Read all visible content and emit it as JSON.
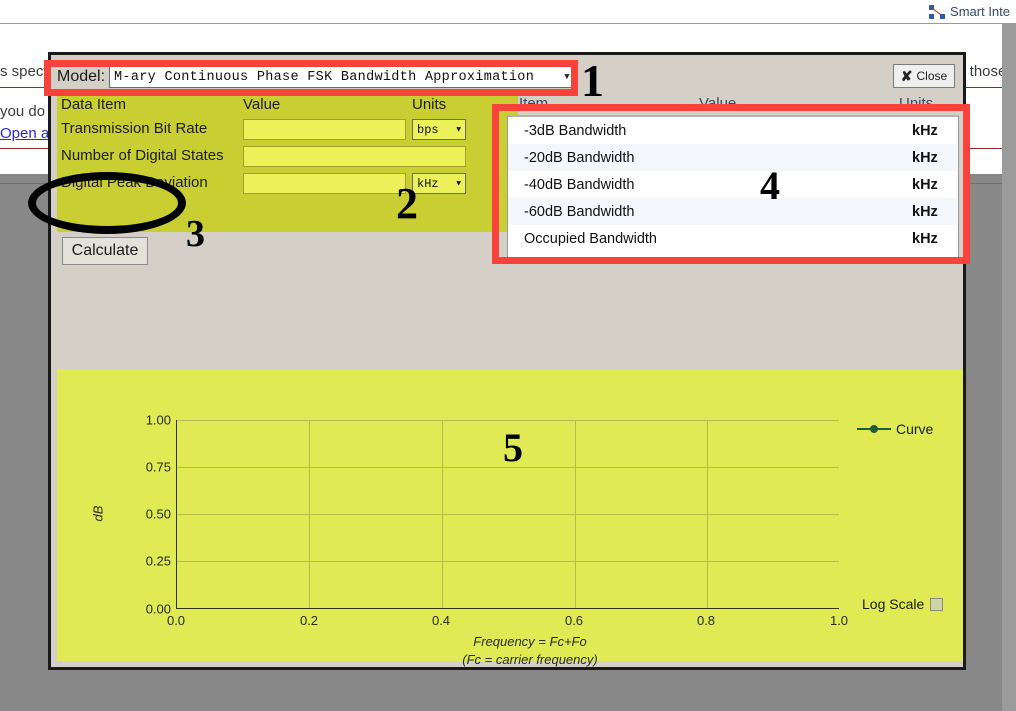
{
  "background": {
    "brand": "Smart Inte",
    "brand_icon": "network-icon",
    "text_left_1": "s spect",
    "text_left_2": "you do",
    "link_left": "Open a",
    "text_right": "s those b"
  },
  "dialog": {
    "model_label": "Model:",
    "model_value": "M-ary Continuous Phase FSK Bandwidth Approximation",
    "close_label": "Close",
    "close_icon": "close-x-icon",
    "form": {
      "headers": {
        "data_item": "Data Item",
        "value": "Value",
        "units": "Units"
      },
      "rows": [
        {
          "label": "Transmission Bit Rate",
          "value": "",
          "unit": "bps",
          "has_unit": true
        },
        {
          "label": "Number of Digital States",
          "value": "",
          "unit": "",
          "has_unit": false
        },
        {
          "label": "Digital Peak Deviation",
          "value": "",
          "unit": "kHz",
          "has_unit": true
        }
      ]
    },
    "calculate_label": "Calculate",
    "results": {
      "headers": {
        "item": "Item",
        "value": "Value",
        "units": "Units"
      },
      "rows": [
        {
          "item": "-3dB Bandwidth",
          "value": "",
          "units": "kHz"
        },
        {
          "item": "-20dB Bandwidth",
          "value": "",
          "units": "kHz"
        },
        {
          "item": "-40dB Bandwidth",
          "value": "",
          "units": "kHz"
        },
        {
          "item": "-60dB Bandwidth",
          "value": "",
          "units": "kHz"
        },
        {
          "item": "Occupied Bandwidth",
          "value": "",
          "units": "kHz"
        }
      ]
    },
    "log_scale_label": "Log Scale",
    "log_scale_checked": false
  },
  "chart_data": {
    "type": "line",
    "title": "",
    "xlabel": "Frequency = Fc+Fo",
    "xlabel_note": "(Fc = carrier frequency)",
    "ylabel": "dB",
    "xlim": [
      0.0,
      1.0
    ],
    "ylim": [
      0.0,
      1.0
    ],
    "xticks": [
      "0.0",
      "0.2",
      "0.4",
      "0.6",
      "0.8",
      "1.0"
    ],
    "yticks": [
      "0.00",
      "0.25",
      "0.50",
      "0.75",
      "1.00"
    ],
    "grid": true,
    "legend_position": "top-right",
    "legend": [
      "Curve"
    ],
    "series": [
      {
        "name": "Curve",
        "color": "#1d5e3a",
        "x": [],
        "values": []
      }
    ]
  },
  "annotations": {
    "numbers": [
      "1",
      "2",
      "3",
      "4",
      "5"
    ],
    "box_color": "#f9423a",
    "ellipse_color": "#000000"
  }
}
